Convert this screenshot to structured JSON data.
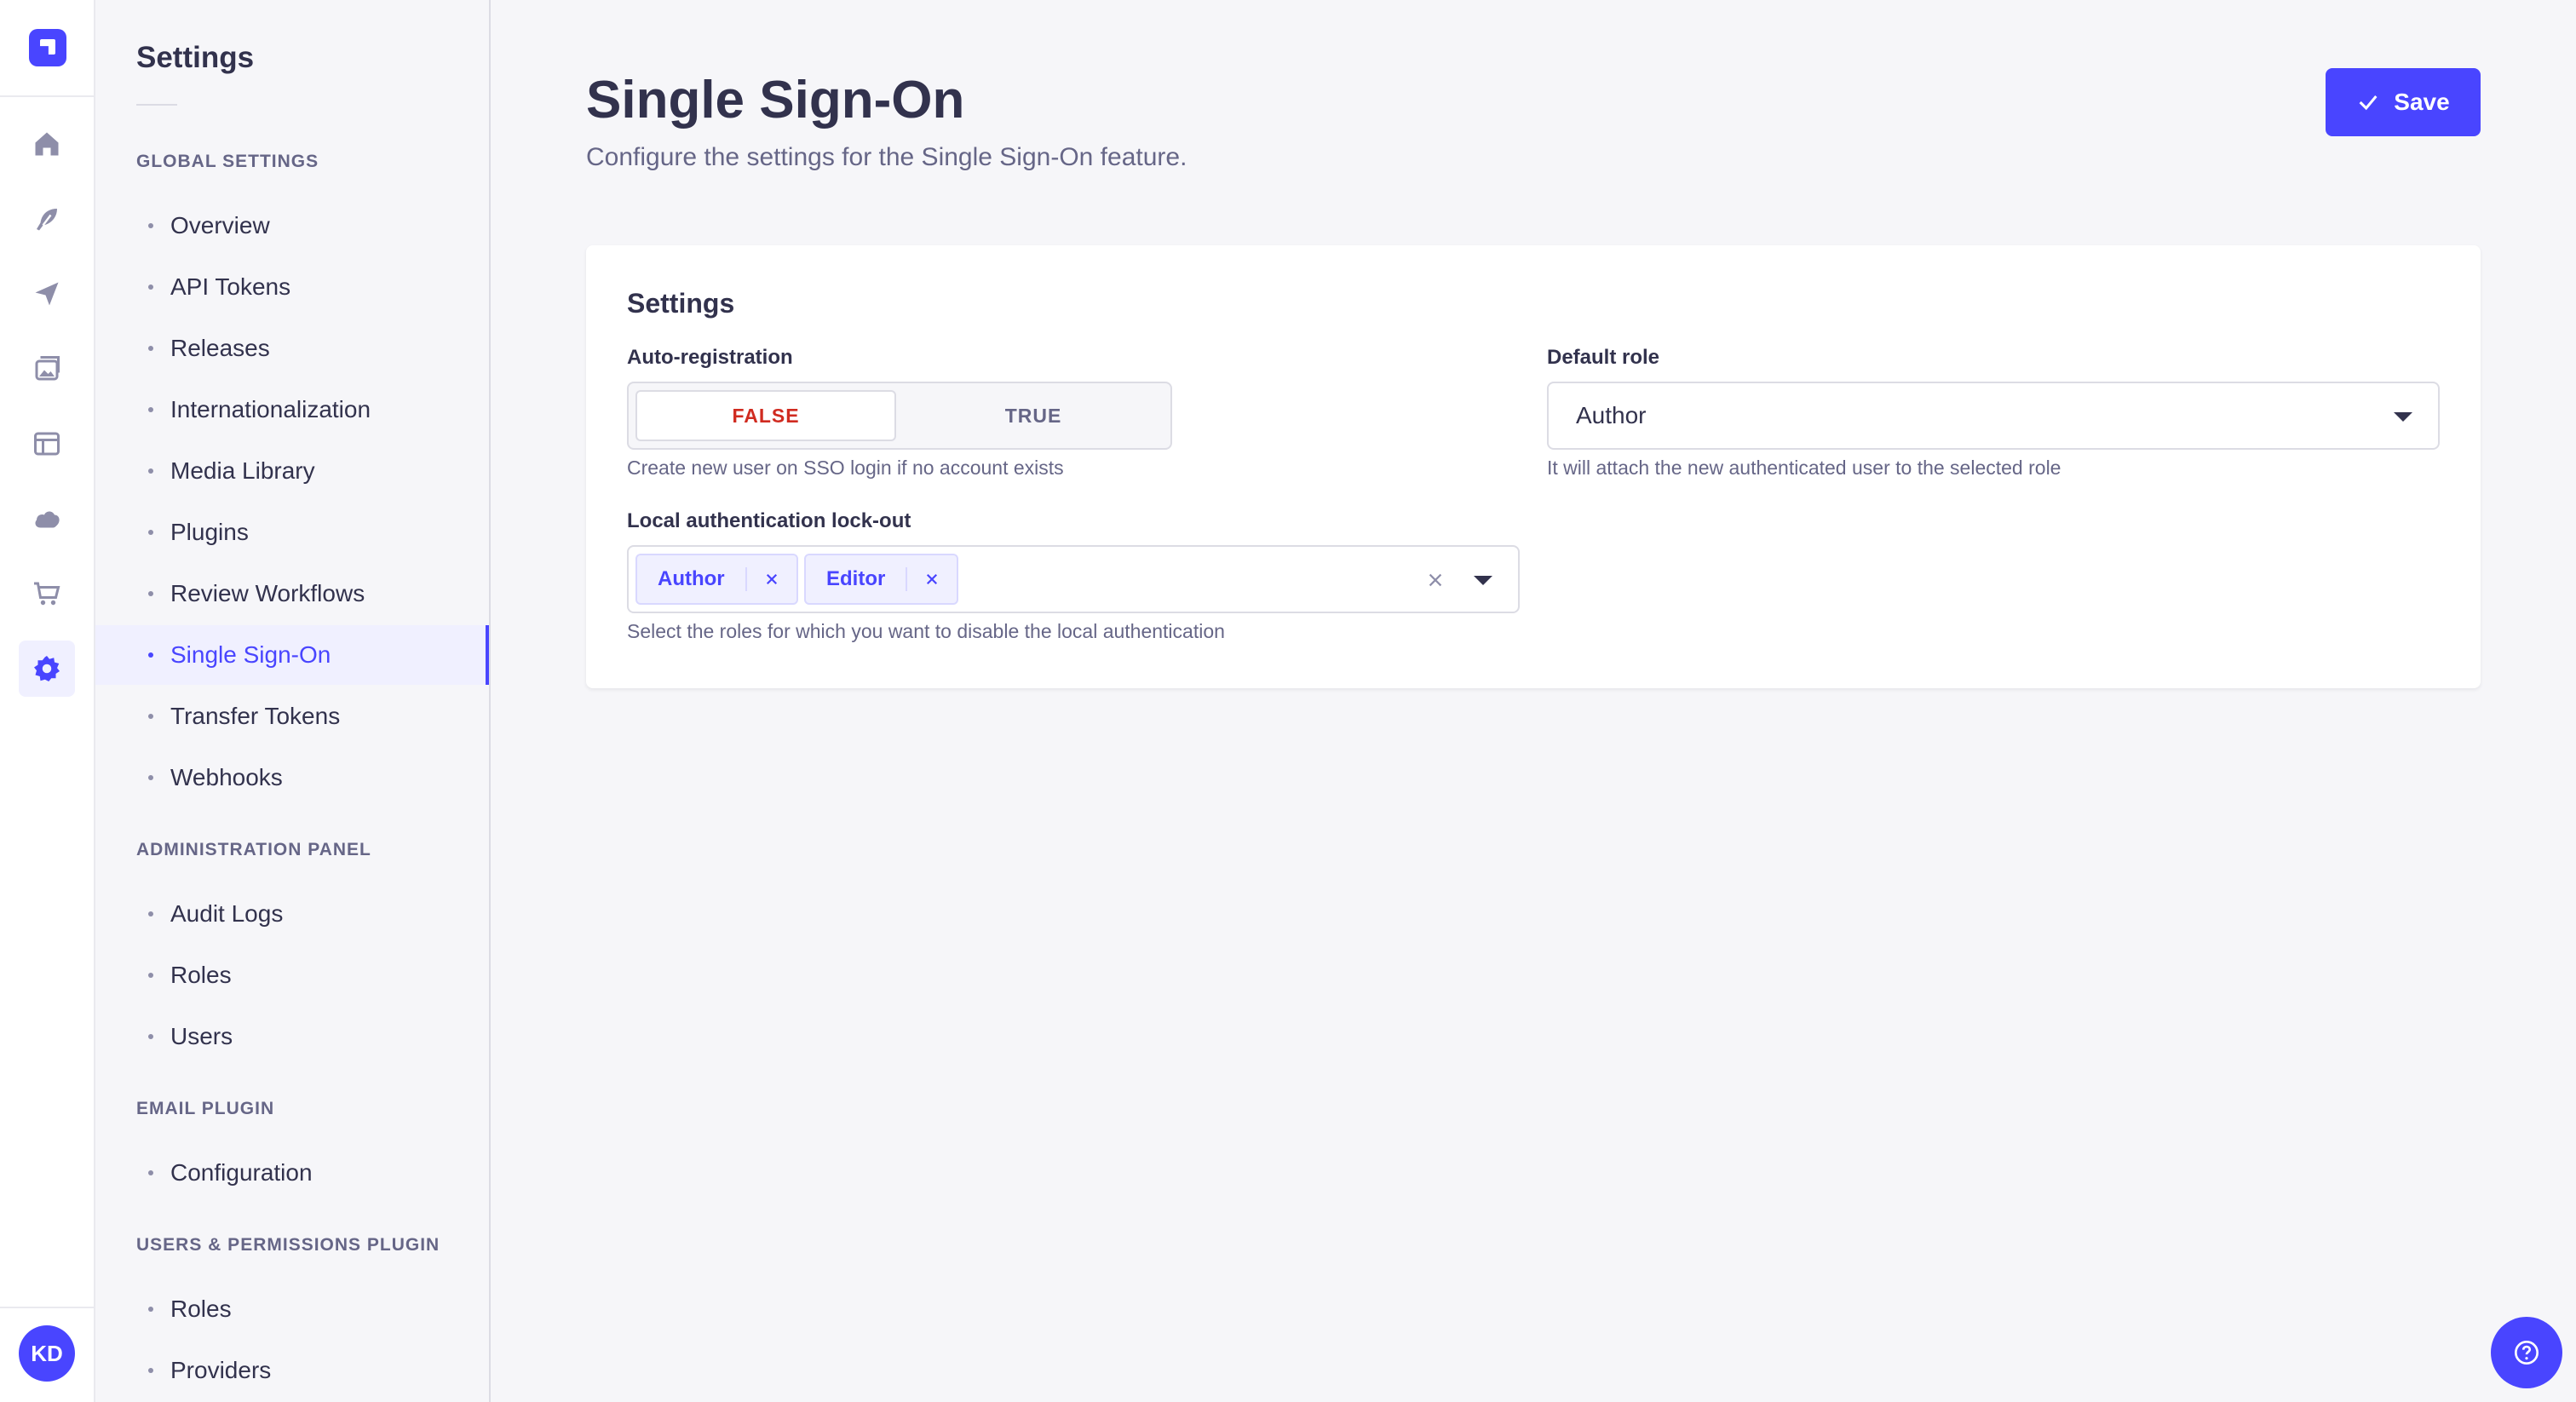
{
  "rail": {
    "icons": [
      "home-icon",
      "feather-icon",
      "paper-plane-icon",
      "images-icon",
      "layout-icon",
      "cloud-icon",
      "cart-icon",
      "cog-icon"
    ],
    "avatar_initials": "KD"
  },
  "subnav": {
    "title": "Settings",
    "sections": [
      {
        "label": "GLOBAL SETTINGS",
        "items": [
          "Overview",
          "API Tokens",
          "Releases",
          "Internationalization",
          "Media Library",
          "Plugins",
          "Review Workflows",
          "Single Sign-On",
          "Transfer Tokens",
          "Webhooks"
        ]
      },
      {
        "label": "ADMINISTRATION PANEL",
        "items": [
          "Audit Logs",
          "Roles",
          "Users"
        ]
      },
      {
        "label": "EMAIL PLUGIN",
        "items": [
          "Configuration"
        ]
      },
      {
        "label": "USERS & PERMISSIONS PLUGIN",
        "items": [
          "Roles",
          "Providers"
        ]
      }
    ],
    "active_item": "Single Sign-On"
  },
  "header": {
    "title": "Single Sign-On",
    "subtitle": "Configure the settings for the Single Sign-On feature.",
    "save_label": "Save"
  },
  "card": {
    "title": "Settings",
    "auto_registration": {
      "label": "Auto-registration",
      "false_label": "FALSE",
      "true_label": "TRUE",
      "selected": "FALSE",
      "hint": "Create new user on SSO login if no account exists"
    },
    "default_role": {
      "label": "Default role",
      "value": "Author",
      "hint": "It will attach the new authenticated user to the selected role"
    },
    "lockout": {
      "label": "Local authentication lock-out",
      "tags": [
        "Author",
        "Editor"
      ],
      "hint": "Select the roles for which you want to disable the local authentication"
    }
  },
  "colors": {
    "primary": "#4945ff",
    "danger": "#d02b20",
    "text": "#32324d",
    "muted": "#666687"
  }
}
